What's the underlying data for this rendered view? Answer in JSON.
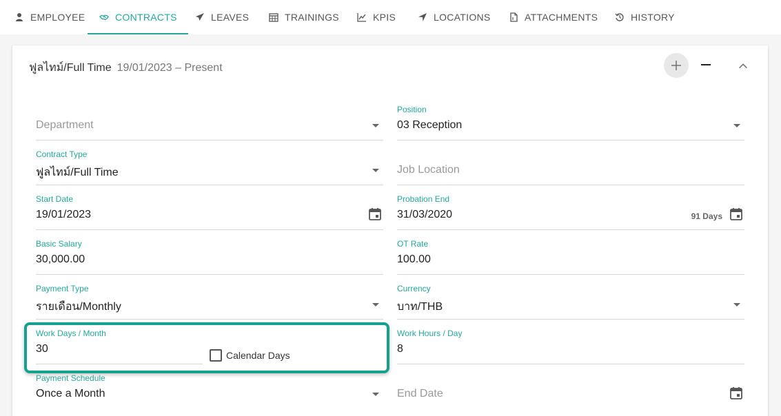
{
  "tabs": [
    {
      "label": "EMPLOYEE",
      "icon": "person-icon",
      "active": false
    },
    {
      "label": "CONTRACTS",
      "icon": "handshake-icon",
      "active": true
    },
    {
      "label": "LEAVES",
      "icon": "airplane-icon",
      "active": false
    },
    {
      "label": "TRAININGS",
      "icon": "calendar-grid-icon",
      "active": false
    },
    {
      "label": "KPIS",
      "icon": "line-chart-icon",
      "active": false
    },
    {
      "label": "LOCATIONS",
      "icon": "location-arrow-icon",
      "active": false
    },
    {
      "label": "ATTACHMENTS",
      "icon": "file-icon",
      "active": false
    },
    {
      "label": "HISTORY",
      "icon": "history-icon",
      "active": false
    }
  ],
  "contract": {
    "title": "ฟูลไทม์/Full Time",
    "period": "19/01/2023 – Present"
  },
  "fields": {
    "department": {
      "placeholder": "Department"
    },
    "position": {
      "label": "Position",
      "value": "03 Reception"
    },
    "contract_type": {
      "label": "Contract Type",
      "value": "ฟูลไทม์/Full Time"
    },
    "job_location": {
      "placeholder": "Job Location"
    },
    "start_date": {
      "label": "Start Date",
      "value": "19/01/2023"
    },
    "probation_end": {
      "label": "Probation End",
      "value": "31/03/2020",
      "note": "91 Days"
    },
    "basic_salary": {
      "label": "Basic Salary",
      "value": "30,000.00"
    },
    "ot_rate": {
      "label": "OT Rate",
      "value": "100.00"
    },
    "payment_type": {
      "label": "Payment Type",
      "value": "รายเดือน/Monthly"
    },
    "currency": {
      "label": "Currency",
      "value": "บาท/THB"
    },
    "work_days": {
      "label": "Work Days / Month",
      "value": "30"
    },
    "calendar_days": {
      "label": "Calendar Days",
      "checked": false
    },
    "work_hours": {
      "label": "Work Hours / Day",
      "value": "8"
    },
    "payment_schedule": {
      "label": "Payment Schedule",
      "value": "Once a Month"
    },
    "end_date": {
      "placeholder": "End Date"
    }
  },
  "colors": {
    "accent": "#26a69a",
    "highlight": "#17a08d"
  }
}
